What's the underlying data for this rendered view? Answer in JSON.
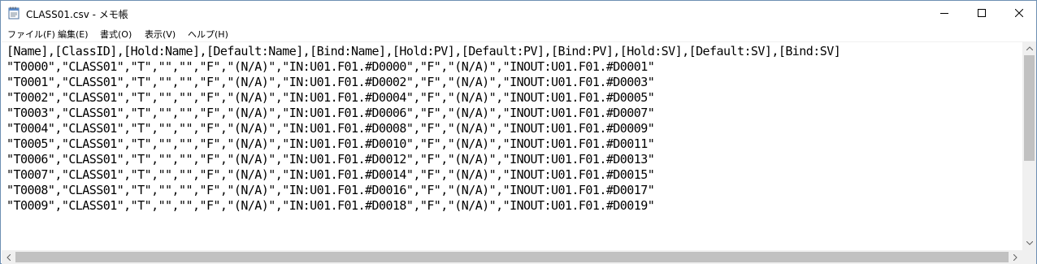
{
  "window": {
    "title": "CLASS01.csv - メモ帳"
  },
  "menu": {
    "items": [
      {
        "label": "ファイル(F)"
      },
      {
        "label": "編集(E)"
      },
      {
        "label": "書式(O)"
      },
      {
        "label": "表示(V)"
      },
      {
        "label": "ヘルプ(H)"
      }
    ]
  },
  "content": {
    "lines": [
      "[Name],[ClassID],[Hold:Name],[Default:Name],[Bind:Name],[Hold:PV],[Default:PV],[Bind:PV],[Hold:SV],[Default:SV],[Bind:SV]",
      "\"T0000\",\"CLASS01\",\"T\",\"\",\"\",\"F\",\"(N/A)\",\"IN:U01.F01.#D0000\",\"F\",\"(N/A)\",\"INOUT:U01.F01.#D0001\"",
      "\"T0001\",\"CLASS01\",\"T\",\"\",\"\",\"F\",\"(N/A)\",\"IN:U01.F01.#D0002\",\"F\",\"(N/A)\",\"INOUT:U01.F01.#D0003\"",
      "\"T0002\",\"CLASS01\",\"T\",\"\",\"\",\"F\",\"(N/A)\",\"IN:U01.F01.#D0004\",\"F\",\"(N/A)\",\"INOUT:U01.F01.#D0005\"",
      "\"T0003\",\"CLASS01\",\"T\",\"\",\"\",\"F\",\"(N/A)\",\"IN:U01.F01.#D0006\",\"F\",\"(N/A)\",\"INOUT:U01.F01.#D0007\"",
      "\"T0004\",\"CLASS01\",\"T\",\"\",\"\",\"F\",\"(N/A)\",\"IN:U01.F01.#D0008\",\"F\",\"(N/A)\",\"INOUT:U01.F01.#D0009\"",
      "\"T0005\",\"CLASS01\",\"T\",\"\",\"\",\"F\",\"(N/A)\",\"IN:U01.F01.#D0010\",\"F\",\"(N/A)\",\"INOUT:U01.F01.#D0011\"",
      "\"T0006\",\"CLASS01\",\"T\",\"\",\"\",\"F\",\"(N/A)\",\"IN:U01.F01.#D0012\",\"F\",\"(N/A)\",\"INOUT:U01.F01.#D0013\"",
      "\"T0007\",\"CLASS01\",\"T\",\"\",\"\",\"F\",\"(N/A)\",\"IN:U01.F01.#D0014\",\"F\",\"(N/A)\",\"INOUT:U01.F01.#D0015\"",
      "\"T0008\",\"CLASS01\",\"T\",\"\",\"\",\"F\",\"(N/A)\",\"IN:U01.F01.#D0016\",\"F\",\"(N/A)\",\"INOUT:U01.F01.#D0017\"",
      "\"T0009\",\"CLASS01\",\"T\",\"\",\"\",\"F\",\"(N/A)\",\"IN:U01.F01.#D0018\",\"F\",\"(N/A)\",\"INOUT:U01.F01.#D0019\""
    ]
  },
  "icons": {
    "app": "notepad-icon",
    "minimize": "minimize-icon",
    "maximize": "maximize-icon",
    "close": "close-icon"
  },
  "colors": {
    "window_border": "#6e8fb3",
    "scrollbar_track": "#f0f0f0",
    "scrollbar_thumb": "#c1c1c1"
  }
}
